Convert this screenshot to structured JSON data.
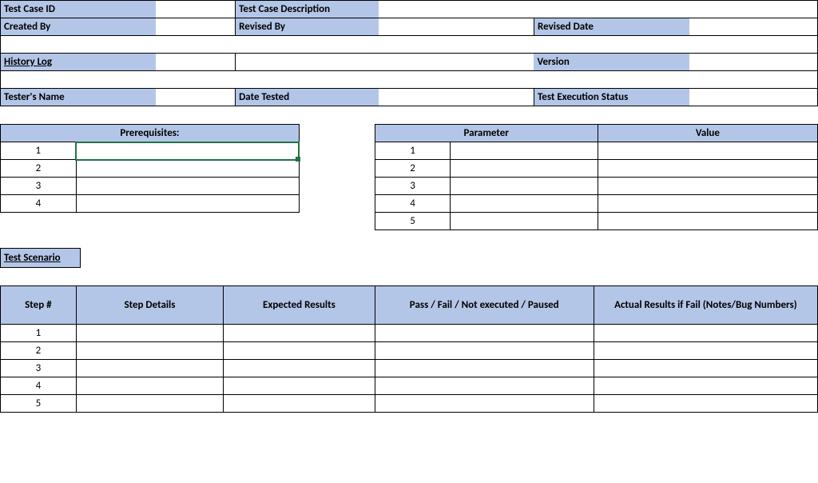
{
  "labels": {
    "testCaseId": "Test Case ID",
    "testCaseDescription": "Test Case Description",
    "createdBy": "Created By",
    "revisedBy": "Revised By",
    "revisedDate": "Revised Date",
    "historyLog": "History Log",
    "version": "Version",
    "testersName": "Tester's Name",
    "dateTested": "Date Tested",
    "testExecStatus": "Test Execution Status",
    "prerequisites": "Prerequisites:",
    "parameter": "Parameter",
    "value": "Value",
    "testScenario": "Test Scenario",
    "stepNum": "Step #",
    "stepDetails": "Step Details",
    "expectedResults": "Expected Results",
    "passFail": "Pass / Fail / Not executed / Paused",
    "actualResults": "Actual Results if Fail (Notes/Bug Numbers)"
  },
  "prereq_rows": [
    "1",
    "2",
    "3",
    "4"
  ],
  "param_rows": [
    "1",
    "2",
    "3",
    "4",
    "5"
  ],
  "step_rows": [
    "1",
    "2",
    "3",
    "4",
    "5"
  ],
  "colors": {
    "header": "#b4c6e7",
    "selection": "#217346"
  }
}
